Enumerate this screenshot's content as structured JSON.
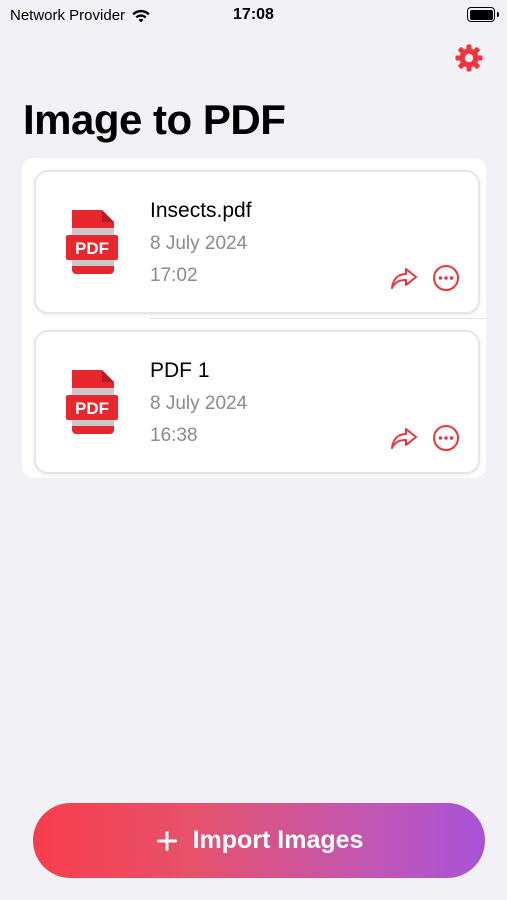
{
  "status_bar": {
    "carrier": "Network Provider",
    "time": "17:08"
  },
  "header": {
    "title": "Image to PDF",
    "settings_icon": "gear-icon"
  },
  "files": [
    {
      "name": "Insects.pdf",
      "date": "8 July 2024",
      "time": "17:02",
      "badge": "PDF"
    },
    {
      "name": "PDF 1",
      "date": "8 July 2024",
      "time": "16:38",
      "badge": "PDF"
    }
  ],
  "import_button": {
    "label": "Import Images",
    "icon": "plus-icon"
  },
  "colors": {
    "accent": "#f2333d",
    "background": "#f2f1f6",
    "secondary_text": "#8a8a8e",
    "gradient_start": "#f73d4d",
    "gradient_end": "#a953d8"
  }
}
